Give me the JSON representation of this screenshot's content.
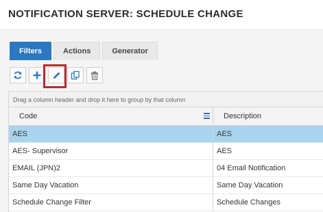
{
  "page": {
    "title": "NOTIFICATION SERVER: SCHEDULE CHANGE"
  },
  "tabs": [
    {
      "label": "Filters",
      "active": true
    },
    {
      "label": "Actions",
      "active": false
    },
    {
      "label": "Generator",
      "active": false
    }
  ],
  "toolbar": {
    "buttons": [
      {
        "icon": "refresh-icon"
      },
      {
        "icon": "plus-icon"
      },
      {
        "icon": "pencil-icon",
        "highlighted": true
      },
      {
        "icon": "copy-icon"
      },
      {
        "icon": "trash-icon"
      }
    ],
    "accent_color": "#2a78c2",
    "highlight_color": "#c0272d"
  },
  "grid": {
    "group_panel_text": "Drag a column header and drop it here to group by that column",
    "columns": [
      "Code",
      "Description"
    ],
    "rows": [
      {
        "code": "AES",
        "description": "AES",
        "selected": true
      },
      {
        "code": "AES- Supervisor",
        "description": "AES",
        "selected": false
      },
      {
        "code": "EMAIL (JPN)2",
        "description": "04 Email Notification",
        "selected": false
      },
      {
        "code": "Same Day Vacation",
        "description": "Same Day Vacation",
        "selected": false
      },
      {
        "code": "Schedule Change Filter",
        "description": "Schedule Changes",
        "selected": false
      }
    ],
    "selected_row_color": "#a9d4ee"
  }
}
